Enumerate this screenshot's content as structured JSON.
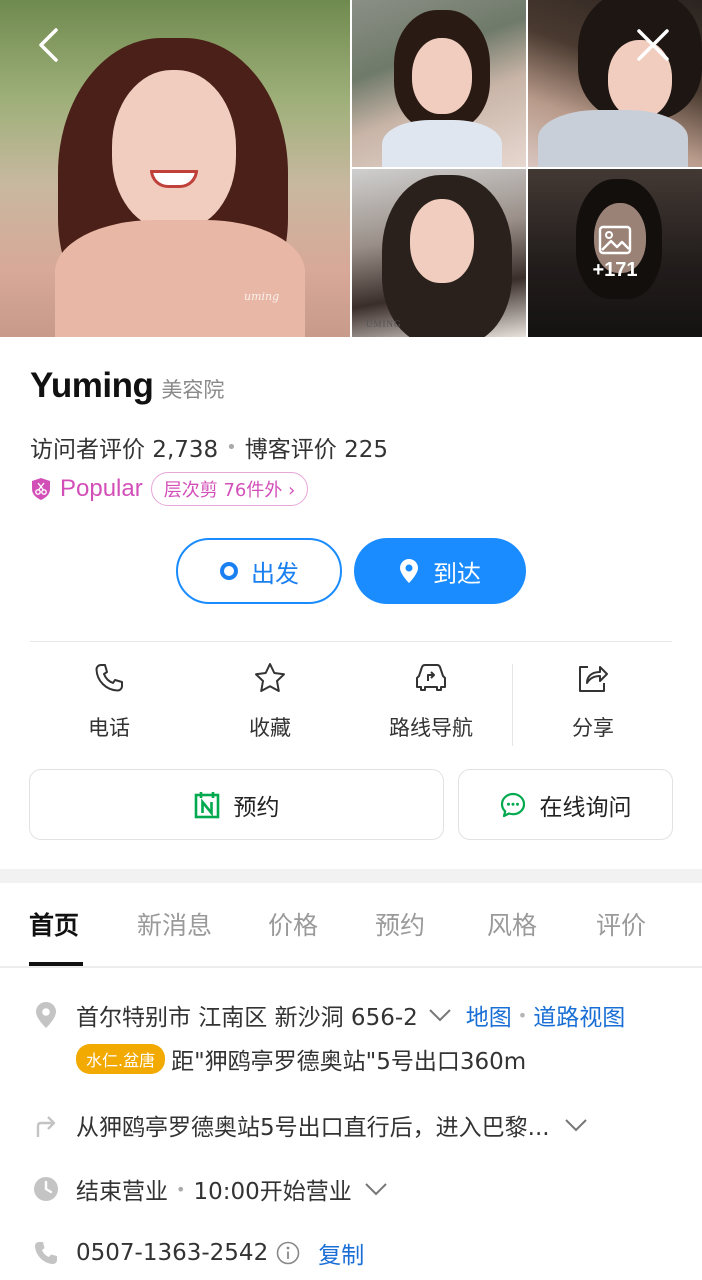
{
  "gallery": {
    "more_count": "+171",
    "watermark": "uming"
  },
  "place": {
    "name": "Yuming",
    "category": "美容院",
    "visitor_reviews": "访问者评价 2,738",
    "blog_reviews": "博客评价 225",
    "popular_label": "Popular",
    "popular_chip": "层次剪 76件外"
  },
  "route": {
    "depart_label": "出发",
    "arrive_label": "到达"
  },
  "actions": [
    {
      "label": "电话",
      "icon": "phone-icon"
    },
    {
      "label": "收藏",
      "icon": "star-icon"
    },
    {
      "label": "路线导航",
      "icon": "car-route-icon"
    },
    {
      "label": "分享",
      "icon": "share-icon"
    }
  ],
  "booking": {
    "reserve_label": "预约",
    "inquiry_label": "在线询问"
  },
  "tabs": [
    "首页",
    "新消息",
    "价格",
    "预约",
    "风格",
    "评价"
  ],
  "details": {
    "address": "首尔特别市 江南区 新沙洞 656-2",
    "map_link": "地图",
    "street_view_link": "道路视图",
    "station_badge": "水仁.盆唐",
    "station_distance": "距\"狎鸥亭罗德奥站\"5号出口360m",
    "directions": "从狎鸥亭罗德奥站5号出口直行后，进入巴黎...",
    "hours_status": "结束营业",
    "hours_next": "10:00开始营业",
    "phone": "0507-1363-2542",
    "copy_link": "复制"
  },
  "colors": {
    "primary": "#1a8cff",
    "popular": "#d34fb8",
    "reserve_green": "#03a94f",
    "station_badge": "#f2a900"
  }
}
